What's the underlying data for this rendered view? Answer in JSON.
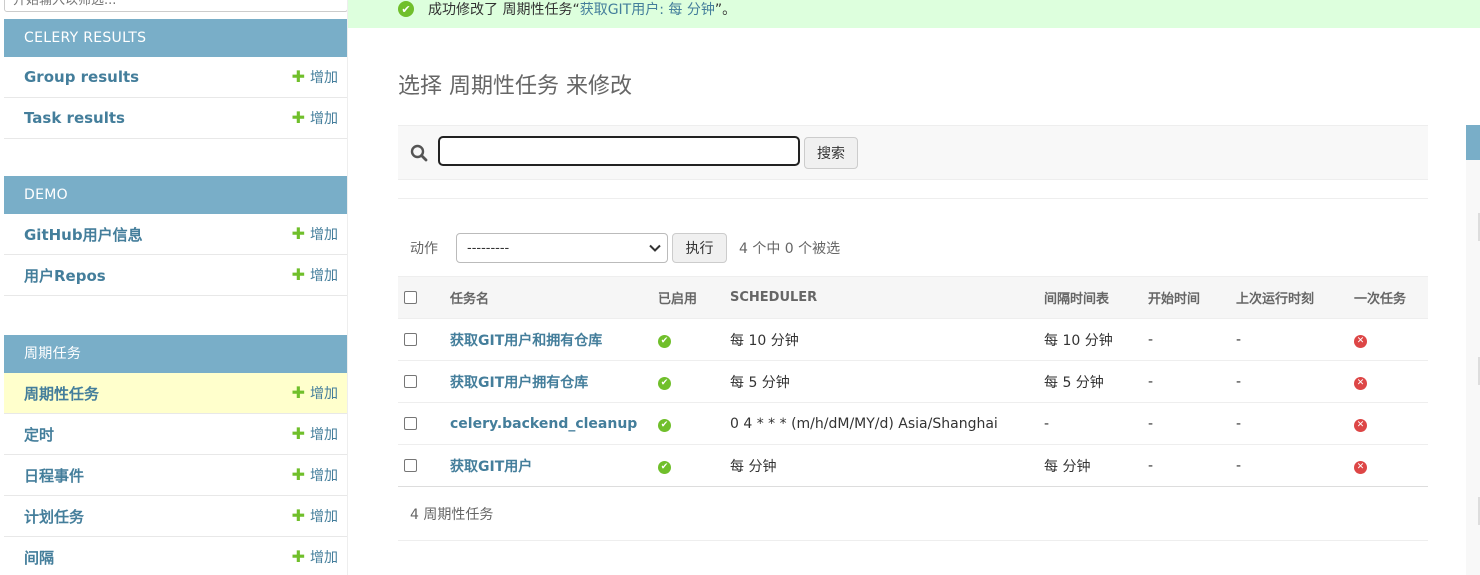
{
  "sidebar": {
    "filter_placeholder": "开始输入以筛选...",
    "modules": [
      {
        "caption": "CELERY RESULTS",
        "models": [
          {
            "name": "Group results",
            "add": "增加",
            "current": false
          },
          {
            "name": "Task results",
            "add": "增加",
            "current": false
          }
        ]
      },
      {
        "caption": "DEMO",
        "models": [
          {
            "name": "GitHub用户信息",
            "add": "增加",
            "current": false
          },
          {
            "name": "用户Repos",
            "add": "增加",
            "current": false
          }
        ]
      },
      {
        "caption": "周期任务",
        "models": [
          {
            "name": "周期性任务",
            "add": "增加",
            "current": true
          },
          {
            "name": "定时",
            "add": "增加",
            "current": false
          },
          {
            "name": "日程事件",
            "add": "增加",
            "current": false
          },
          {
            "name": "计划任务",
            "add": "增加",
            "current": false
          },
          {
            "name": "间隔",
            "add": "增加",
            "current": false
          }
        ]
      }
    ]
  },
  "message": {
    "prefix": "成功修改了 周期性任务“",
    "link": "获取GIT用户: 每 分钟",
    "suffix": "”。"
  },
  "page_title": "选择 周期性任务 来修改",
  "search": {
    "value": "",
    "button": "搜索"
  },
  "actions": {
    "label": "动作",
    "selected": "---------",
    "go": "执行",
    "counter": "4 个中 0 个被选"
  },
  "table": {
    "headers": [
      "任务名",
      "已启用",
      "SCHEDULER",
      "间隔时间表",
      "开始时间",
      "上次运行时刻",
      "一次任务"
    ],
    "rows": [
      {
        "name": "获取GIT用户和拥有仓库",
        "scheduler": "每 10 分钟",
        "interval": "每 10 分钟",
        "start": "-",
        "last_run": "-"
      },
      {
        "name": "获取GIT用户拥有仓库",
        "scheduler": "每 5 分钟",
        "interval": "每 5 分钟",
        "start": "-",
        "last_run": "-"
      },
      {
        "name": "celery.backend_cleanup",
        "scheduler": "0 4 * * * (m/h/dM/MY/d) Asia/Shanghai",
        "interval": "-",
        "start": "-",
        "last_run": "-"
      },
      {
        "name": "获取GIT用户",
        "scheduler": "每 分钟",
        "interval": "每 分钟",
        "start": "-",
        "last_run": "-"
      }
    ]
  },
  "paginator": "4 周期性任务",
  "colors": {
    "module_caption": "#79aec8",
    "link": "#447e9b",
    "success_bg": "#dddddd",
    "current_row": "#ffffcc",
    "yes": "#70bf2b",
    "no": "#dd4646"
  },
  "icons": {
    "success": "success-check-icon",
    "search": "magnifier-icon",
    "add": "plus-icon",
    "enabled": "icon-yes",
    "one_off": "icon-no"
  }
}
